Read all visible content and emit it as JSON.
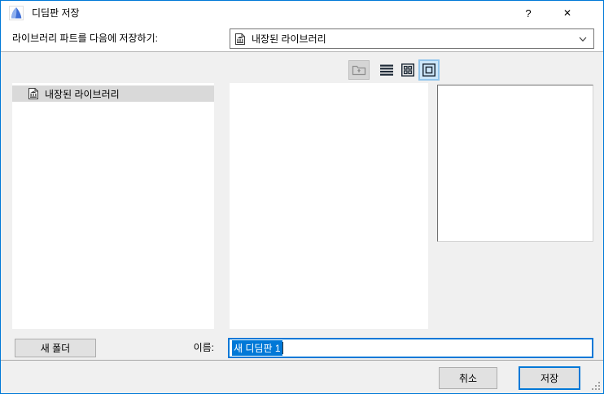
{
  "window": {
    "title": "디딤판 저장",
    "help_glyph": "?",
    "close_glyph": "✕"
  },
  "colors": {
    "accent": "#0078d7",
    "dialog_bg": "#f0f0f0",
    "header_bg": "#ffffff",
    "tree_selection_bg": "#d9d9d9",
    "text_selection_bg": "#0078d7",
    "toolbar_selected_bg": "#cde6f9"
  },
  "save_to": {
    "label": "라이브러리 파트를 다음에 저장하기:",
    "selected_option": "내장된 라이브러리",
    "icon": "library-part-icon"
  },
  "toolbar": {
    "buttons": [
      {
        "name": "folder-up",
        "icon": "folder-up-icon",
        "state": "disabled"
      },
      {
        "name": "list-view",
        "icon": "list-view-icon",
        "state": "normal"
      },
      {
        "name": "small-icons-view",
        "icon": "small-icons-view-icon",
        "state": "normal"
      },
      {
        "name": "large-icon-view",
        "icon": "large-icon-view-icon",
        "state": "selected"
      }
    ]
  },
  "folder_tree": {
    "items": [
      {
        "label": "내장된 라이브러리",
        "icon": "library-part-icon",
        "selected": true
      }
    ]
  },
  "file_list": {
    "items": []
  },
  "preview": {
    "content": ""
  },
  "name_row": {
    "new_folder_button": "새 폴더",
    "name_label": "이름:",
    "name_value": "새 디딤판 1",
    "value_selected": true
  },
  "action_buttons": {
    "cancel": "취소",
    "save": "저장"
  }
}
